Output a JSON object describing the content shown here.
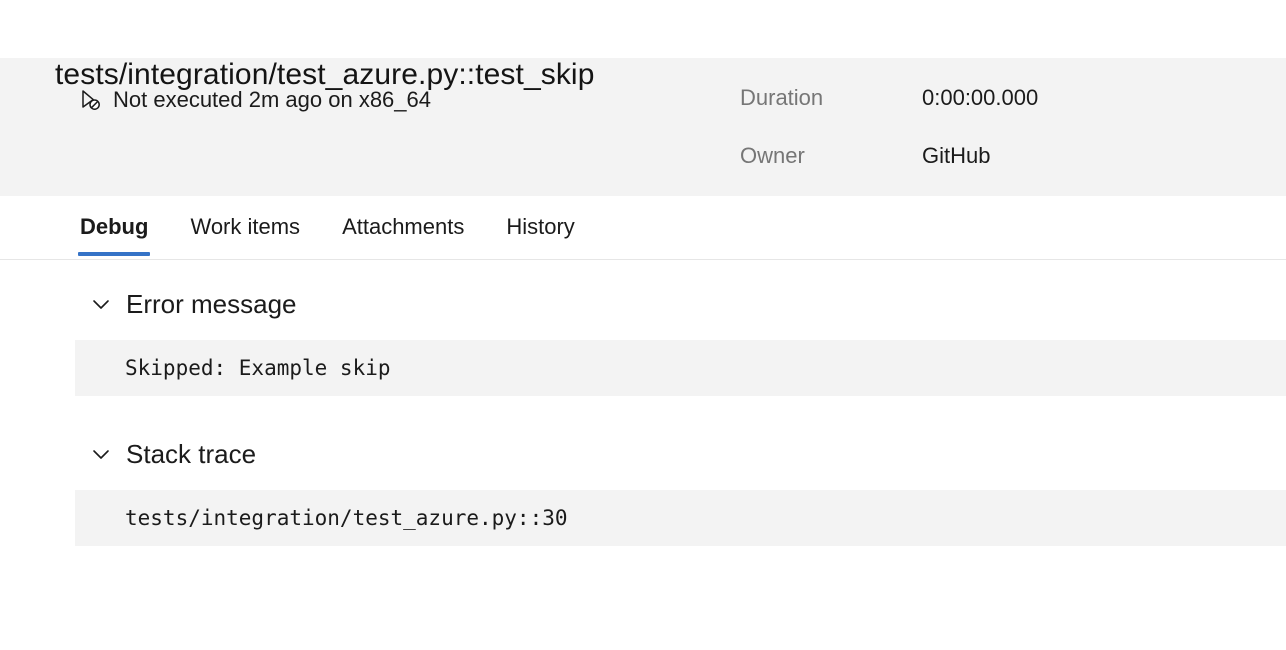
{
  "page_title": "tests/integration/test_azure.py::test_skip",
  "summary": {
    "status_icon": "skipped-run-icon",
    "status_text": "Not executed 2m ago on x86_64",
    "meta": [
      {
        "label": "Duration",
        "value": "0:00:00.000"
      },
      {
        "label": "Owner",
        "value": "GitHub"
      }
    ]
  },
  "tabs": [
    {
      "label": "Debug",
      "active": true
    },
    {
      "label": "Work items",
      "active": false
    },
    {
      "label": "Attachments",
      "active": false
    },
    {
      "label": "History",
      "active": false
    }
  ],
  "sections": [
    {
      "title": "Error message",
      "expanded": true,
      "chevron": "chevron-down-icon",
      "content": "Skipped: Example skip"
    },
    {
      "title": "Stack trace",
      "expanded": true,
      "chevron": "chevron-down-icon",
      "content": "tests/integration/test_azure.py::30"
    }
  ],
  "colors": {
    "accent": "#3573c7",
    "band_background": "#f3f3f3",
    "code_background": "#f3f3f3",
    "muted_text": "#767676",
    "primary_text": "#1b1b1b",
    "divider": "#e6e6e6"
  }
}
